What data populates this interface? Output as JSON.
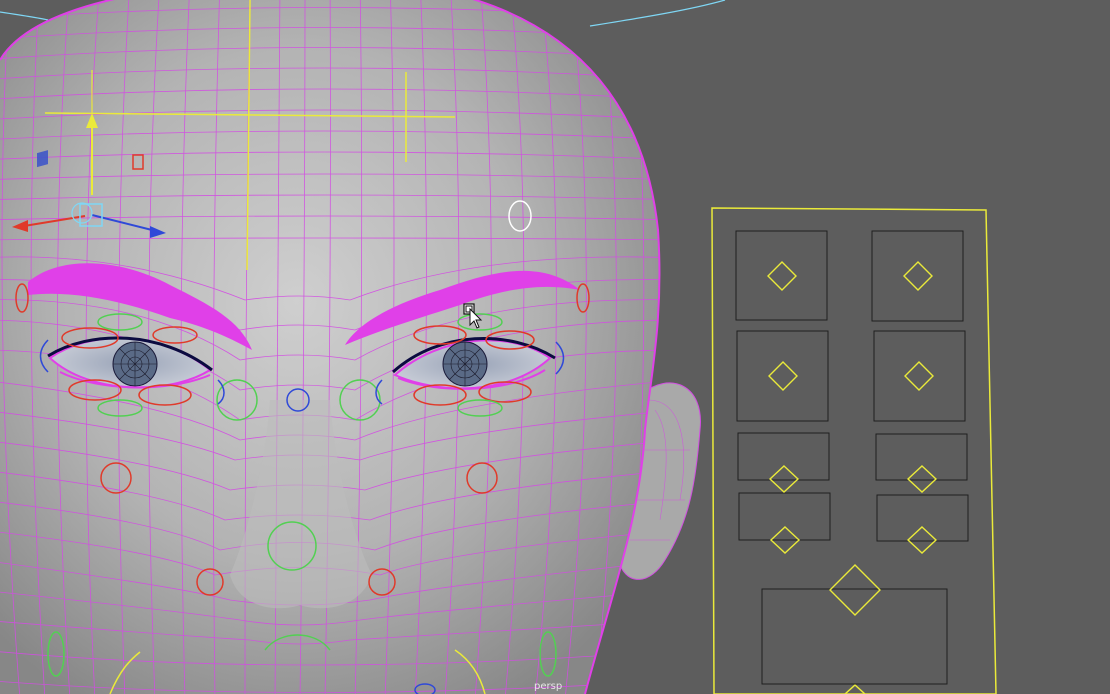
{
  "viewport": {
    "camera_label": "persp"
  },
  "colors": {
    "background": "#5d5d5d",
    "wireframe": "#d34de3",
    "selection_magenta": "#e040e8",
    "control_yellow": "#eaea3a",
    "control_red": "#e03a2a",
    "control_green": "#52d052",
    "control_blue": "#2f49d8",
    "highlight_cyan": "#7fd7f5",
    "panel_outline": "#1f1f1f"
  },
  "icons": [
    "move-manipulator-icon",
    "mouse-cursor-icon"
  ]
}
